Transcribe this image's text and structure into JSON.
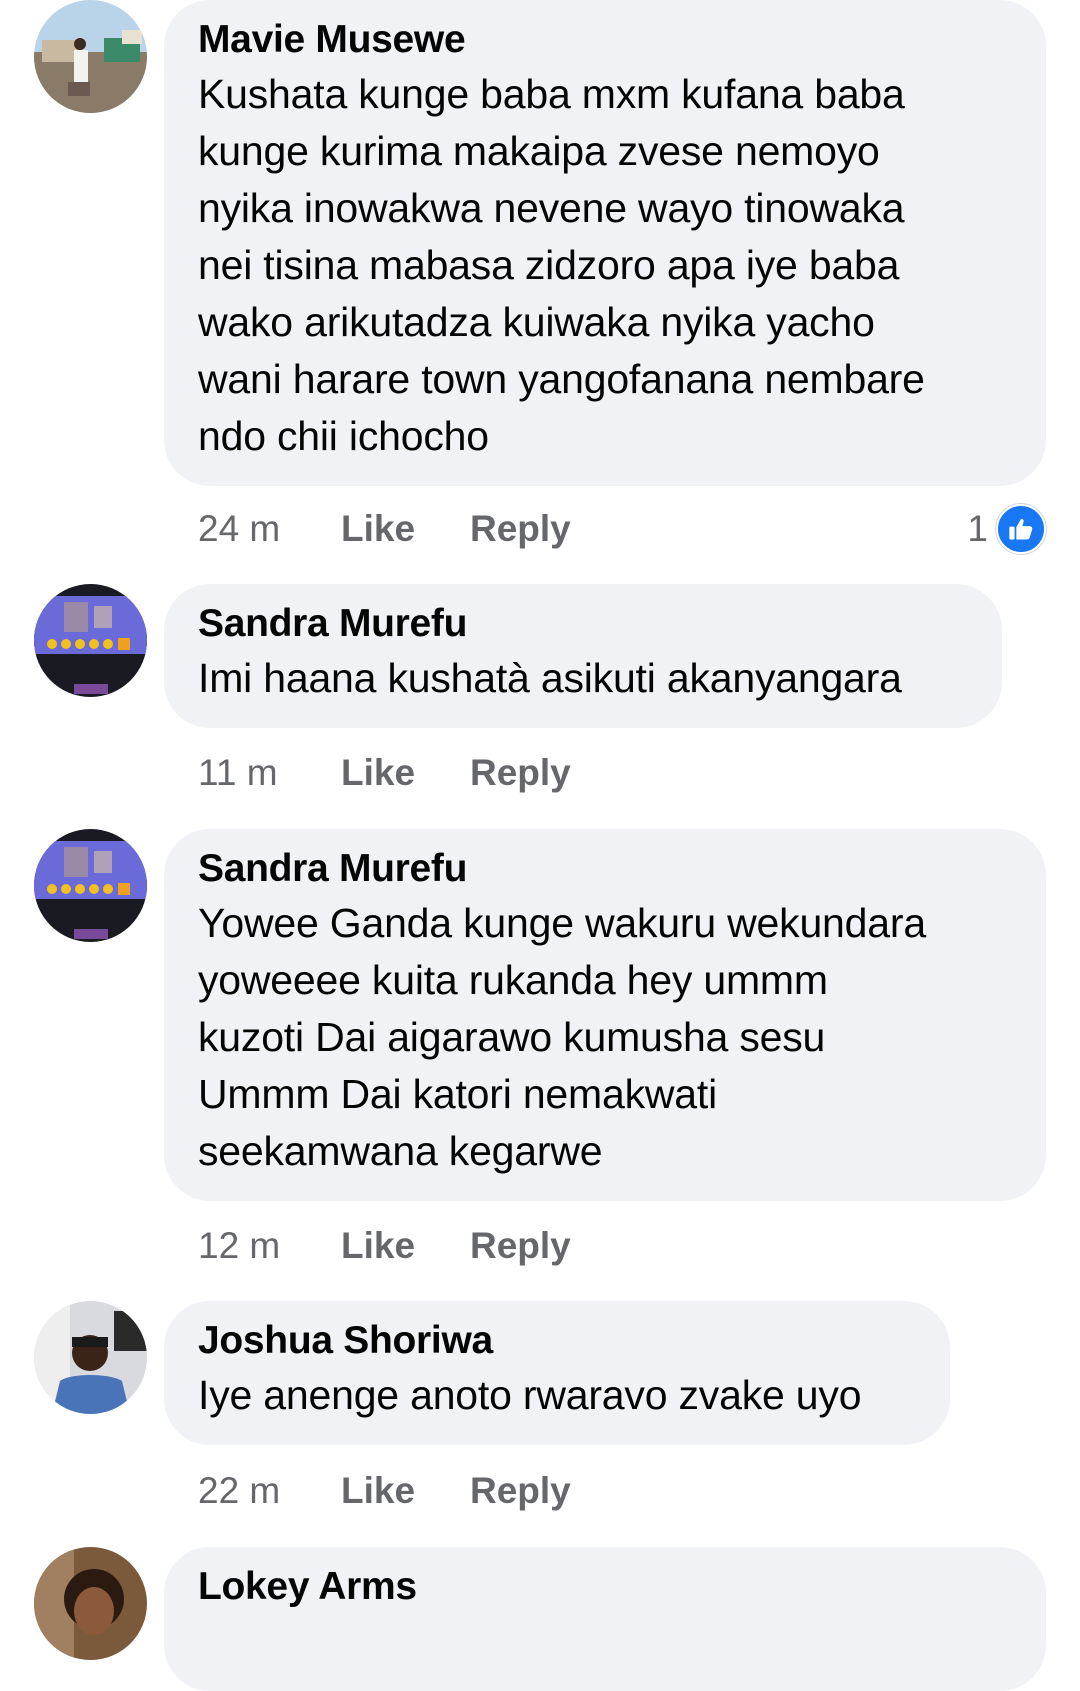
{
  "comments": [
    {
      "author": "Mavie Musewe",
      "text": "Kushata kunge baba mxm kufana baba\nkunge kurima makaipa zvese nemoyo\nnyika inowakwa nevene wayo tinowaka\nnei tisina mabasa zidzoro apa  iye baba\nwako arikutadza kuiwaka nyika yacho\nwani harare town yangofanana nembare\nndo chii ichocho",
      "time": "24 m",
      "like_label": "Like",
      "reply_label": "Reply",
      "reaction_count": "1",
      "reaction_icon": "thumbs-up-icon",
      "reaction_color": "#1877f2"
    },
    {
      "author": "Sandra Murefu",
      "text": "Imi haana kushatà asikuti akanyangara",
      "time": "11 m",
      "like_label": "Like",
      "reply_label": "Reply"
    },
    {
      "author": "Sandra Murefu",
      "text": "Yowee Ganda kunge wakuru wekundara\nyoweeee kuita rukanda hey  ummm\nkuzoti Dai aigarawo kumusha sesu\nUmmm Dai katori nemakwati\nseekamwana kegarwe",
      "time": "12 m",
      "like_label": "Like",
      "reply_label": "Reply"
    },
    {
      "author": "Joshua Shoriwa",
      "text": "Iye anenge anoto rwaravo zvake uyo",
      "time": "22 m",
      "like_label": "Like",
      "reply_label": "Reply"
    },
    {
      "author": "Lokey Arms"
    }
  ]
}
